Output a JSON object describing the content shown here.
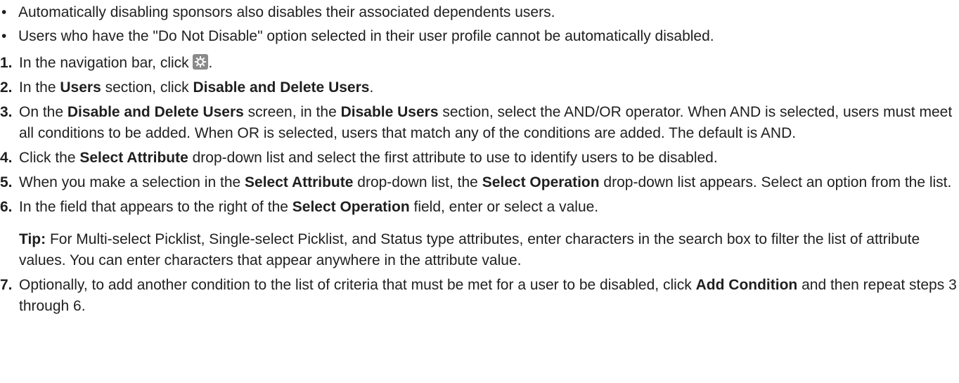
{
  "bullets": [
    "Automatically disabling sponsors also disables their associated dependents users.",
    "Users who have the \"Do Not Disable\" option selected in their user profile cannot be automatically disabled."
  ],
  "steps": {
    "s1": {
      "num": "1.",
      "pre": "In the navigation bar, click ",
      "post": ".",
      "icon": "gear-icon"
    },
    "s2": {
      "num": "2.",
      "a": "In the ",
      "b1": "Users",
      "c": " section, click ",
      "b2": "Disable and Delete Users",
      "d": "."
    },
    "s3": {
      "num": "3.",
      "a": "On the ",
      "b1": "Disable and Delete Users",
      "c": " screen, in the ",
      "b2": "Disable Users",
      "d": " section, select the AND/OR operator. When AND is selected, users must meet all conditions to be added. When OR is selected, users that match any of the conditions are added. The default is AND."
    },
    "s4": {
      "num": "4.",
      "a": "Click the ",
      "b1": "Select Attribute",
      "c": " drop-down list and select the first attribute to use to identify users to be disabled."
    },
    "s5": {
      "num": "5.",
      "a": "When you make a selection in the ",
      "b1": "Select Attribute",
      "c": " drop-down list, the ",
      "b2": "Select Operation",
      "d": " drop-down list appears. Select an option from the list."
    },
    "s6": {
      "num": "6.",
      "a": "In the field that appears to the right of the ",
      "b1": "Select Operation",
      "c": " field, enter or select a value.",
      "tip_label": "Tip:",
      "tip_text": "  For Multi-select Picklist, Single-select Picklist, and Status type attributes, enter characters in the search box to filter the list of attribute values. You can enter characters that appear anywhere in the attribute value."
    },
    "s7": {
      "num": "7.",
      "a": "Optionally, to add another condition to the list of criteria that must be met for a user to be disabled, click ",
      "b1": "Add Condition",
      "c": " and then repeat steps 3 through 6."
    }
  }
}
